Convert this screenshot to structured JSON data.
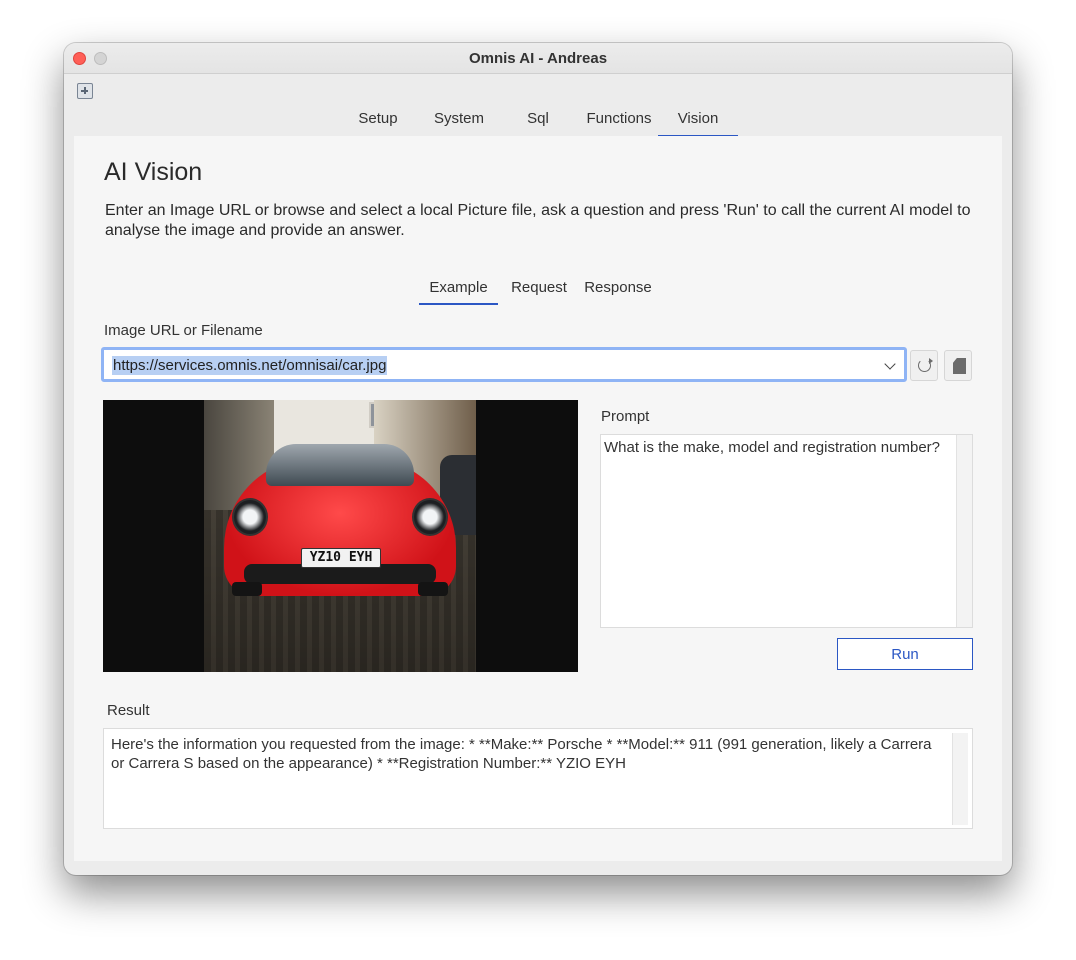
{
  "window": {
    "title": "Omnis AI - Andreas"
  },
  "tabs": [
    {
      "label": "Setup"
    },
    {
      "label": "System"
    },
    {
      "label": "Sql"
    },
    {
      "label": "Functions"
    },
    {
      "label": "Vision"
    }
  ],
  "page": {
    "title": "AI Vision",
    "description": "Enter an Image URL or browse and select a local Picture file, ask a question and press 'Run' to call the current AI model to analyse the image and provide an answer."
  },
  "sub_tabs": [
    {
      "label": "Example"
    },
    {
      "label": "Request"
    },
    {
      "label": "Response"
    }
  ],
  "image_source": {
    "label": "Image URL or Filename",
    "value": "https://services.omnis.net/omnisai/car.jpg"
  },
  "image": {
    "plate_text": "YZ10 EYH"
  },
  "prompt": {
    "label": "Prompt",
    "value": "What is the make, model and registration number?"
  },
  "run_label": "Run",
  "result": {
    "label": "Result",
    "value": "Here's the information you requested from the image:  * **Make:** Porsche * **Model:** 911 (991 generation, likely a Carrera or Carrera S based on the appearance) * **Registration Number:** YZIO EYH"
  },
  "colors": {
    "accent": "#2b57c4",
    "focus_ring": "#8fb4f5",
    "selection": "#b7cff3"
  },
  "icons": [
    "add-window-icon",
    "chevron-down-icon",
    "refresh-icon",
    "sd-card-icon"
  ]
}
